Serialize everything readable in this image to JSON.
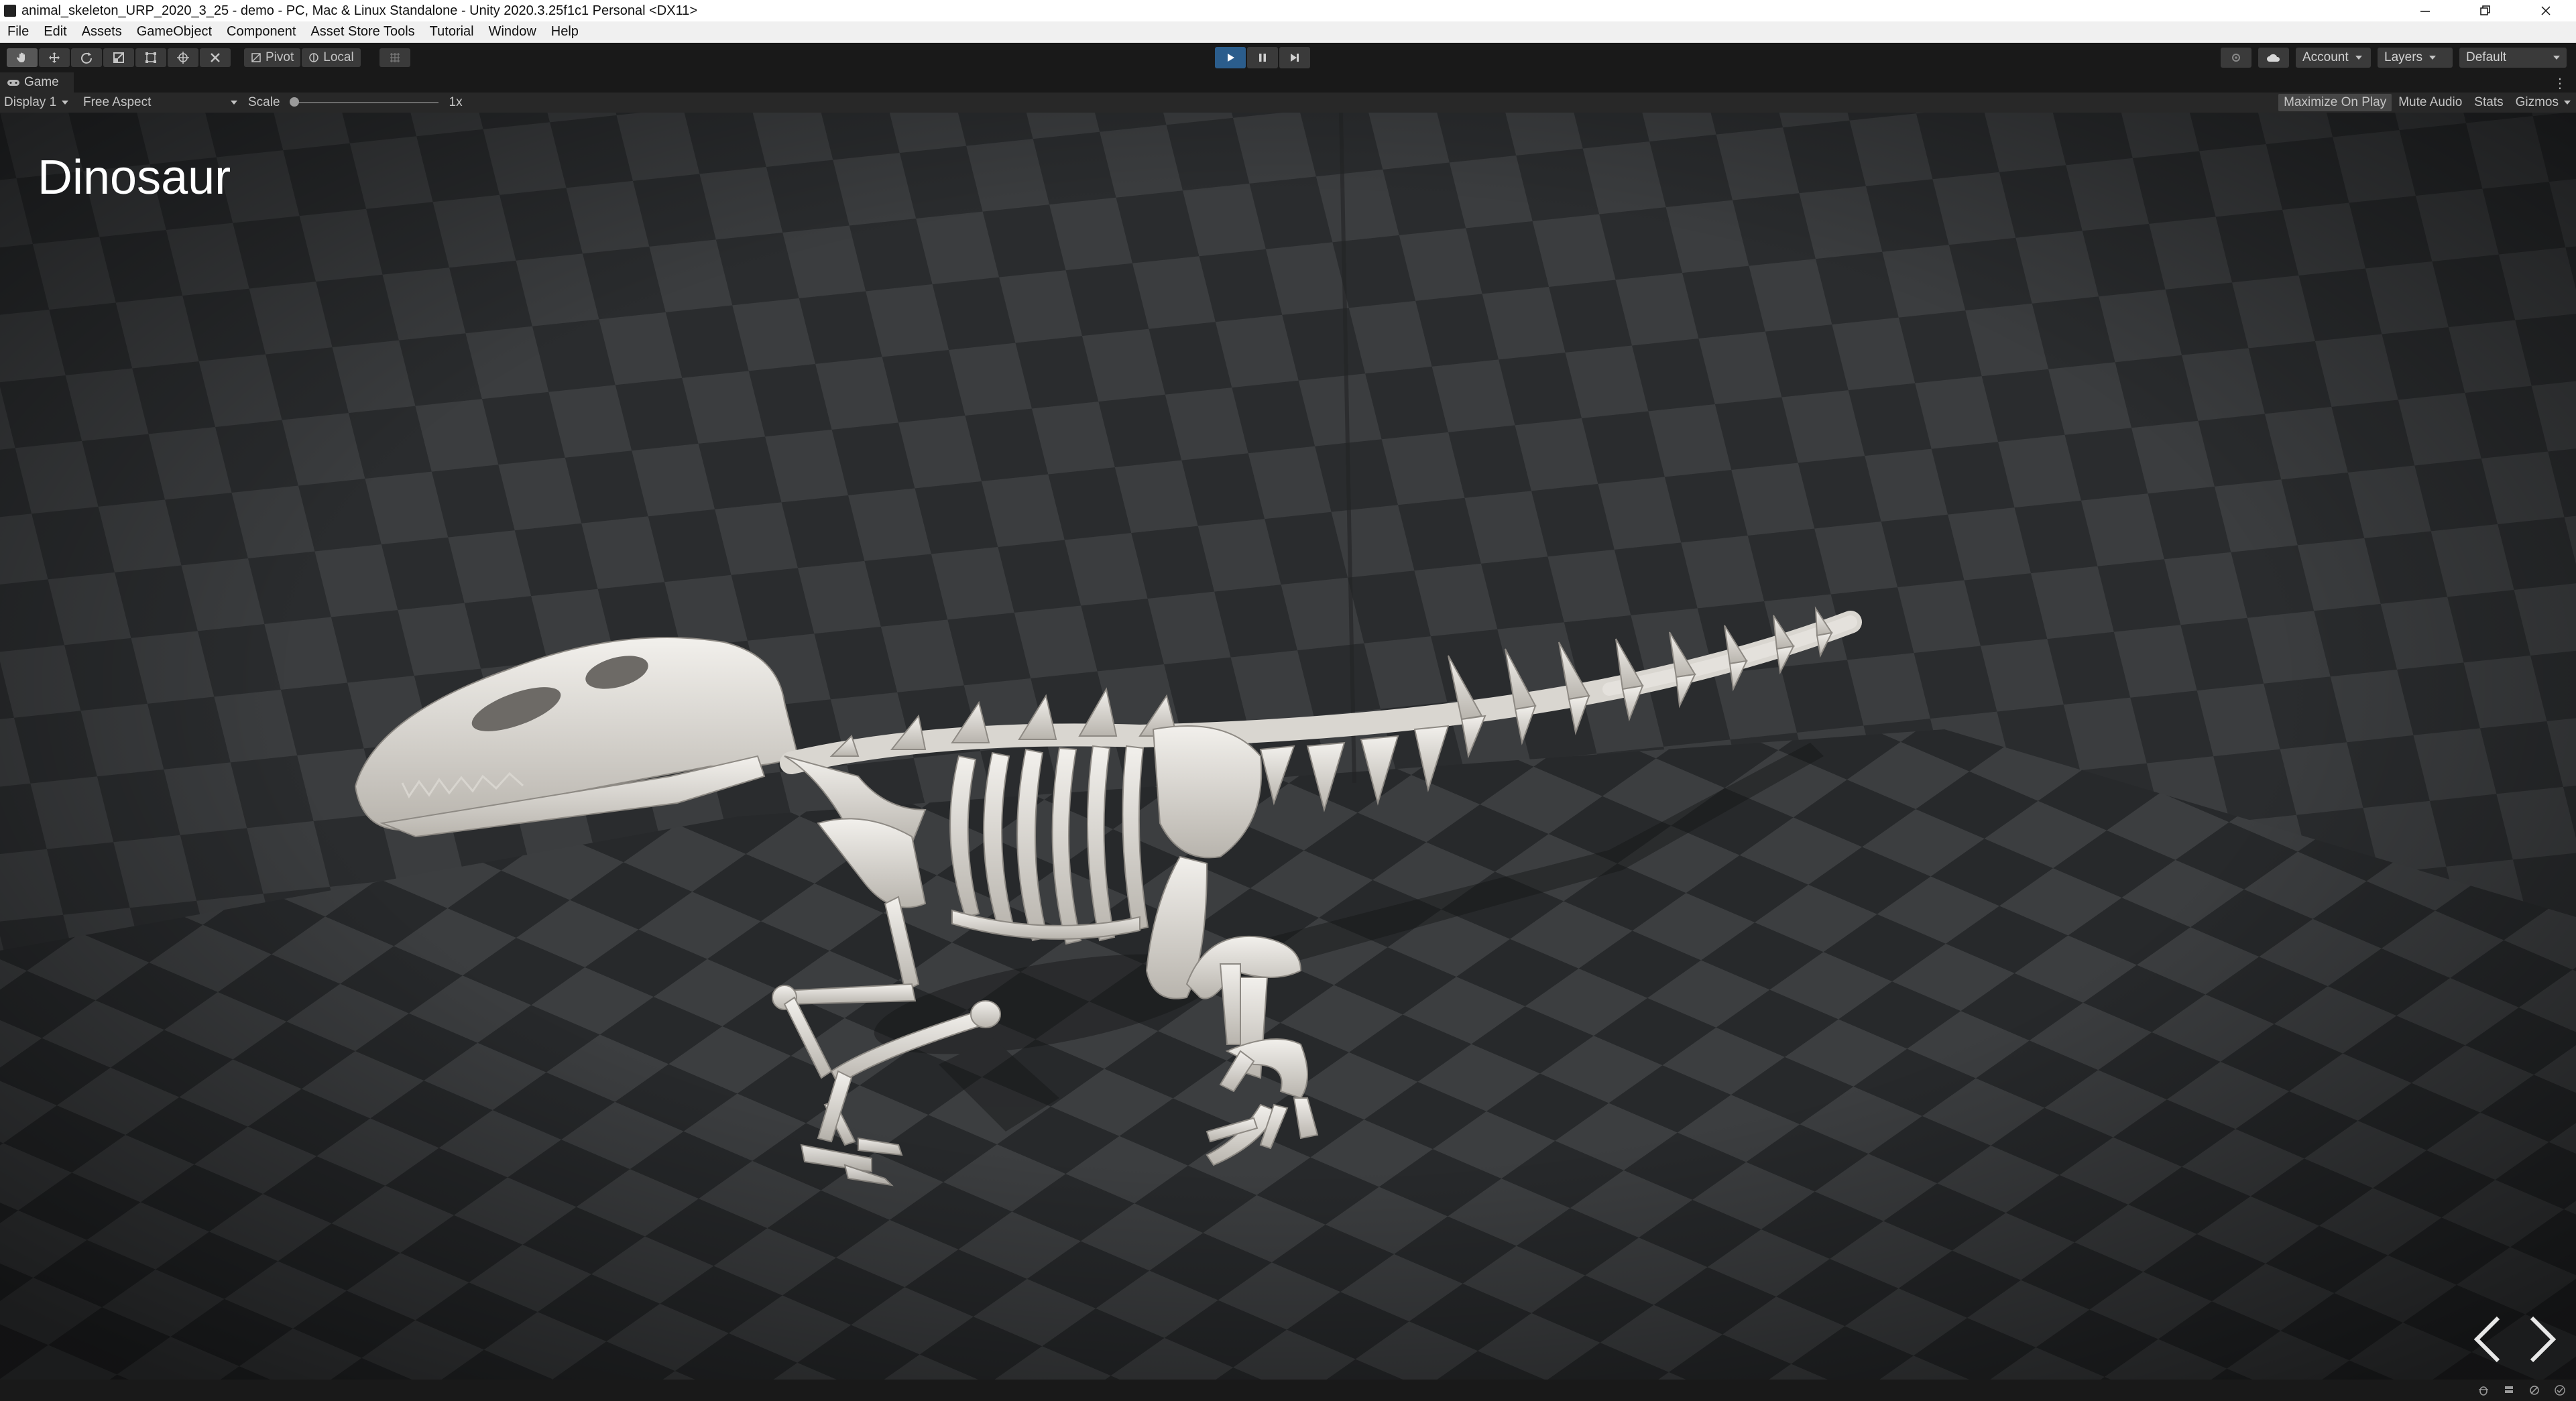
{
  "window": {
    "title": "animal_skeleton_URP_2020_3_25 - demo - PC, Mac & Linux Standalone - Unity 2020.3.25f1c1 Personal <DX11>",
    "controls": [
      "minimize",
      "restore",
      "close"
    ]
  },
  "menu": [
    "File",
    "Edit",
    "Assets",
    "GameObject",
    "Component",
    "Asset Store Tools",
    "Tutorial",
    "Window",
    "Help"
  ],
  "toolbar": {
    "tools": [
      "hand-tool",
      "move-tool",
      "rotate-tool",
      "scale-tool",
      "rect-tool",
      "transform-tool",
      "custom-tool"
    ],
    "pivot_label": "Pivot",
    "local_label": "Local",
    "play_state": "playing",
    "account_label": "Account",
    "layers_label": "Layers",
    "layout_label": "Default"
  },
  "game_tab": {
    "label": "Game"
  },
  "game_toolbar": {
    "display": "Display 1",
    "aspect": "Free Aspect",
    "scale_label": "Scale",
    "scale_value": "1x",
    "maximize_on_play": "Maximize On Play",
    "mute_audio": "Mute Audio",
    "stats": "Stats",
    "gizmos": "Gizmos"
  },
  "scene": {
    "title": "Dinosaur",
    "nav_prev": "previous",
    "nav_next": "next"
  },
  "colors": {
    "play_active": "#2b5d8c",
    "bone": "#e6e3dd",
    "floor_dark": "#2b2d2f",
    "floor_light": "#3d3f41"
  }
}
